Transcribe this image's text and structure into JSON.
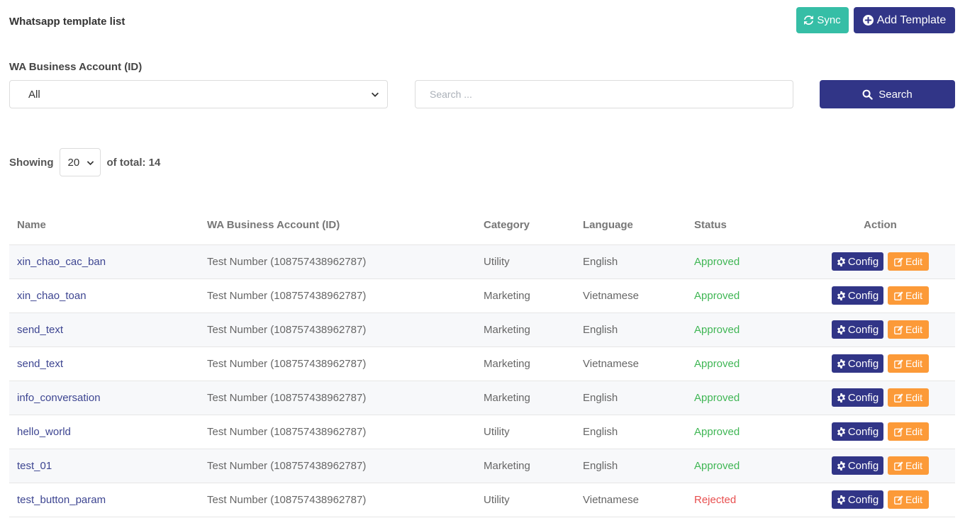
{
  "header": {
    "title": "Whatsapp template list",
    "sync_label": "Sync",
    "add_label": "Add Template"
  },
  "filters": {
    "account_label": "WA Business Account (ID)",
    "account_selected": "All",
    "search_placeholder": "Search ...",
    "search_label": "Search"
  },
  "pagination": {
    "showing_label": "Showing",
    "page_size": "20",
    "total_label": "of total: 14"
  },
  "table": {
    "columns": [
      "Name",
      "WA Business Account (ID)",
      "Category",
      "Language",
      "Status",
      "Action"
    ],
    "config_label": "Config",
    "edit_label": "Edit",
    "rows": [
      {
        "name": "xin_chao_cac_ban",
        "account": "Test Number (108757438962787)",
        "category": "Utility",
        "language": "English",
        "status": "Approved"
      },
      {
        "name": "xin_chao_toan",
        "account": "Test Number (108757438962787)",
        "category": "Marketing",
        "language": "Vietnamese",
        "status": "Approved"
      },
      {
        "name": "send_text",
        "account": "Test Number (108757438962787)",
        "category": "Marketing",
        "language": "English",
        "status": "Approved"
      },
      {
        "name": "send_text",
        "account": "Test Number (108757438962787)",
        "category": "Marketing",
        "language": "Vietnamese",
        "status": "Approved"
      },
      {
        "name": "info_conversation",
        "account": "Test Number (108757438962787)",
        "category": "Marketing",
        "language": "English",
        "status": "Approved"
      },
      {
        "name": "hello_world",
        "account": "Test Number (108757438962787)",
        "category": "Utility",
        "language": "English",
        "status": "Approved"
      },
      {
        "name": "test_01",
        "account": "Test Number (108757438962787)",
        "category": "Marketing",
        "language": "English",
        "status": "Approved"
      },
      {
        "name": "test_button_param",
        "account": "Test Number (108757438962787)",
        "category": "Utility",
        "language": "Vietnamese",
        "status": "Rejected"
      }
    ]
  },
  "colors": {
    "primary": "#313587",
    "sync": "#36bea6",
    "edit": "#fc9a38",
    "approved": "#3fb654",
    "rejected": "#e84f4f"
  },
  "icons": {
    "sync": "refresh-icon",
    "add": "plus-circle-icon",
    "search": "search-icon",
    "config": "gear-icon",
    "edit": "edit-icon",
    "select": "chevron-down-icon"
  }
}
